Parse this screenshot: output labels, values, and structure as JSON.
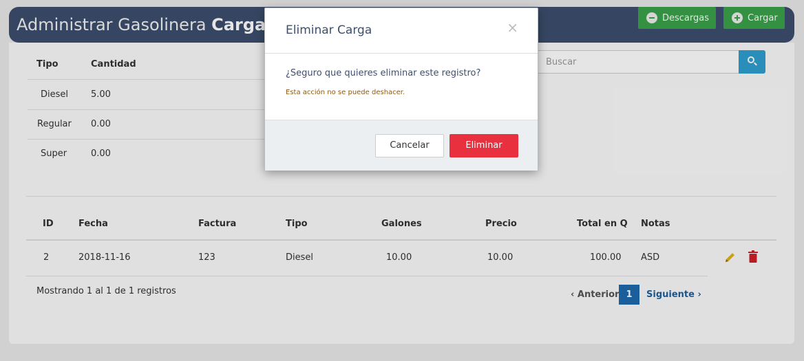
{
  "header": {
    "title_prefix": "Administrar Gasolinera",
    "title_bold": "Cargas",
    "descargas_label": "Descargas",
    "cargar_label": "Cargar"
  },
  "summary": {
    "headers": [
      "Tipo",
      "Cantidad"
    ],
    "rows": [
      {
        "tipo": "Diesel",
        "cantidad": "5.00"
      },
      {
        "tipo": "Regular",
        "cantidad": "0.00"
      },
      {
        "tipo": "Super",
        "cantidad": "0.00"
      }
    ]
  },
  "search": {
    "placeholder": "Buscar"
  },
  "table": {
    "headers": [
      "ID",
      "Fecha",
      "Factura",
      "Tipo",
      "Galones",
      "Precio",
      "Total en Q",
      "Notas"
    ],
    "rows": [
      {
        "id": "2",
        "fecha": "2018-11-16",
        "factura": "123",
        "tipo": "Diesel",
        "galones": "10.00",
        "precio": "10.00",
        "total": "100.00",
        "notas": "ASD"
      }
    ]
  },
  "footer": {
    "info": "Mostrando 1 al 1 de 1 registros",
    "prev": "‹ Anterior",
    "page": "1",
    "next": "Siguiente ›"
  },
  "modal": {
    "title": "Eliminar Carga",
    "close": "×",
    "question": "¿Seguro que quieres eliminar este registro?",
    "warning": "Esta acción no se puede deshacer.",
    "cancel_label": "Cancelar",
    "delete_label": "Eliminar"
  },
  "colors": {
    "header_bg": "#3d4f6e",
    "success": "#3aa24a",
    "danger": "#e8303f",
    "primary": "#1d6aad",
    "info": "#2f9fd0",
    "edit_icon": "#e0b41c"
  },
  "icons": [
    "minus-circle-icon",
    "plus-circle-icon",
    "search-icon",
    "pencil-icon",
    "trash-icon",
    "close-icon"
  ]
}
